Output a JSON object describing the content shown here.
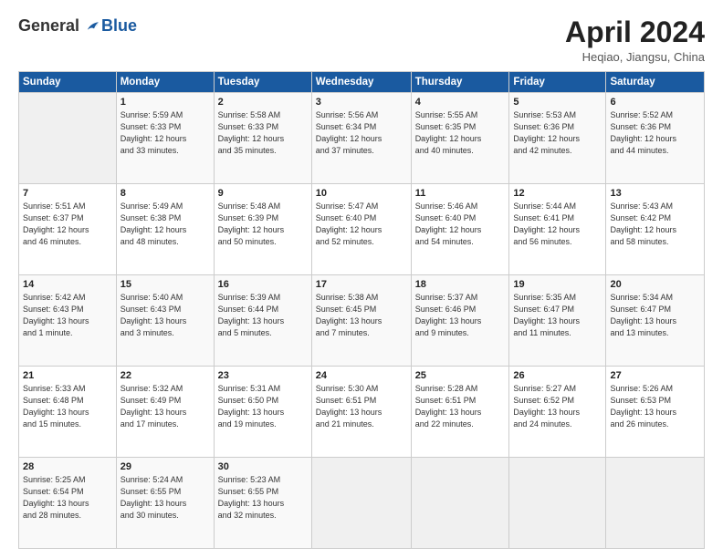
{
  "header": {
    "logo_general": "General",
    "logo_blue": "Blue",
    "title": "April 2024",
    "location": "Heqiao, Jiangsu, China"
  },
  "days_of_week": [
    "Sunday",
    "Monday",
    "Tuesday",
    "Wednesday",
    "Thursday",
    "Friday",
    "Saturday"
  ],
  "weeks": [
    [
      {
        "day": "",
        "empty": true
      },
      {
        "day": "1",
        "line1": "Sunrise: 5:59 AM",
        "line2": "Sunset: 6:33 PM",
        "line3": "Daylight: 12 hours",
        "line4": "and 33 minutes."
      },
      {
        "day": "2",
        "line1": "Sunrise: 5:58 AM",
        "line2": "Sunset: 6:33 PM",
        "line3": "Daylight: 12 hours",
        "line4": "and 35 minutes."
      },
      {
        "day": "3",
        "line1": "Sunrise: 5:56 AM",
        "line2": "Sunset: 6:34 PM",
        "line3": "Daylight: 12 hours",
        "line4": "and 37 minutes."
      },
      {
        "day": "4",
        "line1": "Sunrise: 5:55 AM",
        "line2": "Sunset: 6:35 PM",
        "line3": "Daylight: 12 hours",
        "line4": "and 40 minutes."
      },
      {
        "day": "5",
        "line1": "Sunrise: 5:53 AM",
        "line2": "Sunset: 6:36 PM",
        "line3": "Daylight: 12 hours",
        "line4": "and 42 minutes."
      },
      {
        "day": "6",
        "line1": "Sunrise: 5:52 AM",
        "line2": "Sunset: 6:36 PM",
        "line3": "Daylight: 12 hours",
        "line4": "and 44 minutes."
      }
    ],
    [
      {
        "day": "7",
        "line1": "Sunrise: 5:51 AM",
        "line2": "Sunset: 6:37 PM",
        "line3": "Daylight: 12 hours",
        "line4": "and 46 minutes."
      },
      {
        "day": "8",
        "line1": "Sunrise: 5:49 AM",
        "line2": "Sunset: 6:38 PM",
        "line3": "Daylight: 12 hours",
        "line4": "and 48 minutes."
      },
      {
        "day": "9",
        "line1": "Sunrise: 5:48 AM",
        "line2": "Sunset: 6:39 PM",
        "line3": "Daylight: 12 hours",
        "line4": "and 50 minutes."
      },
      {
        "day": "10",
        "line1": "Sunrise: 5:47 AM",
        "line2": "Sunset: 6:40 PM",
        "line3": "Daylight: 12 hours",
        "line4": "and 52 minutes."
      },
      {
        "day": "11",
        "line1": "Sunrise: 5:46 AM",
        "line2": "Sunset: 6:40 PM",
        "line3": "Daylight: 12 hours",
        "line4": "and 54 minutes."
      },
      {
        "day": "12",
        "line1": "Sunrise: 5:44 AM",
        "line2": "Sunset: 6:41 PM",
        "line3": "Daylight: 12 hours",
        "line4": "and 56 minutes."
      },
      {
        "day": "13",
        "line1": "Sunrise: 5:43 AM",
        "line2": "Sunset: 6:42 PM",
        "line3": "Daylight: 12 hours",
        "line4": "and 58 minutes."
      }
    ],
    [
      {
        "day": "14",
        "line1": "Sunrise: 5:42 AM",
        "line2": "Sunset: 6:43 PM",
        "line3": "Daylight: 13 hours",
        "line4": "and 1 minute."
      },
      {
        "day": "15",
        "line1": "Sunrise: 5:40 AM",
        "line2": "Sunset: 6:43 PM",
        "line3": "Daylight: 13 hours",
        "line4": "and 3 minutes."
      },
      {
        "day": "16",
        "line1": "Sunrise: 5:39 AM",
        "line2": "Sunset: 6:44 PM",
        "line3": "Daylight: 13 hours",
        "line4": "and 5 minutes."
      },
      {
        "day": "17",
        "line1": "Sunrise: 5:38 AM",
        "line2": "Sunset: 6:45 PM",
        "line3": "Daylight: 13 hours",
        "line4": "and 7 minutes."
      },
      {
        "day": "18",
        "line1": "Sunrise: 5:37 AM",
        "line2": "Sunset: 6:46 PM",
        "line3": "Daylight: 13 hours",
        "line4": "and 9 minutes."
      },
      {
        "day": "19",
        "line1": "Sunrise: 5:35 AM",
        "line2": "Sunset: 6:47 PM",
        "line3": "Daylight: 13 hours",
        "line4": "and 11 minutes."
      },
      {
        "day": "20",
        "line1": "Sunrise: 5:34 AM",
        "line2": "Sunset: 6:47 PM",
        "line3": "Daylight: 13 hours",
        "line4": "and 13 minutes."
      }
    ],
    [
      {
        "day": "21",
        "line1": "Sunrise: 5:33 AM",
        "line2": "Sunset: 6:48 PM",
        "line3": "Daylight: 13 hours",
        "line4": "and 15 minutes."
      },
      {
        "day": "22",
        "line1": "Sunrise: 5:32 AM",
        "line2": "Sunset: 6:49 PM",
        "line3": "Daylight: 13 hours",
        "line4": "and 17 minutes."
      },
      {
        "day": "23",
        "line1": "Sunrise: 5:31 AM",
        "line2": "Sunset: 6:50 PM",
        "line3": "Daylight: 13 hours",
        "line4": "and 19 minutes."
      },
      {
        "day": "24",
        "line1": "Sunrise: 5:30 AM",
        "line2": "Sunset: 6:51 PM",
        "line3": "Daylight: 13 hours",
        "line4": "and 21 minutes."
      },
      {
        "day": "25",
        "line1": "Sunrise: 5:28 AM",
        "line2": "Sunset: 6:51 PM",
        "line3": "Daylight: 13 hours",
        "line4": "and 22 minutes."
      },
      {
        "day": "26",
        "line1": "Sunrise: 5:27 AM",
        "line2": "Sunset: 6:52 PM",
        "line3": "Daylight: 13 hours",
        "line4": "and 24 minutes."
      },
      {
        "day": "27",
        "line1": "Sunrise: 5:26 AM",
        "line2": "Sunset: 6:53 PM",
        "line3": "Daylight: 13 hours",
        "line4": "and 26 minutes."
      }
    ],
    [
      {
        "day": "28",
        "line1": "Sunrise: 5:25 AM",
        "line2": "Sunset: 6:54 PM",
        "line3": "Daylight: 13 hours",
        "line4": "and 28 minutes."
      },
      {
        "day": "29",
        "line1": "Sunrise: 5:24 AM",
        "line2": "Sunset: 6:55 PM",
        "line3": "Daylight: 13 hours",
        "line4": "and 30 minutes."
      },
      {
        "day": "30",
        "line1": "Sunrise: 5:23 AM",
        "line2": "Sunset: 6:55 PM",
        "line3": "Daylight: 13 hours",
        "line4": "and 32 minutes."
      },
      {
        "day": "",
        "empty": true
      },
      {
        "day": "",
        "empty": true
      },
      {
        "day": "",
        "empty": true
      },
      {
        "day": "",
        "empty": true
      }
    ]
  ]
}
